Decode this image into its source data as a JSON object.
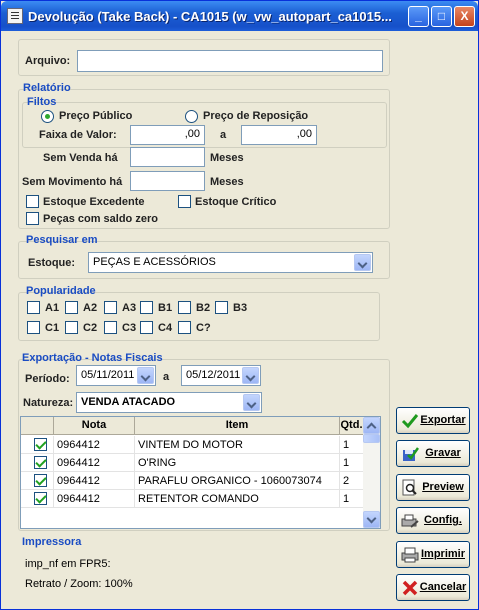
{
  "window": {
    "title": "Devolução (Take Back) - CA1015 (w_vw_autopart_ca1015...",
    "buttons": {
      "minimize": "_",
      "maximize": "□",
      "close": "X"
    }
  },
  "arquivo": {
    "label": "Arquivo:",
    "value": ""
  },
  "relatorio": {
    "title": "Relatório",
    "filtros_title": "Filtos",
    "radio_publico": "Preço Público",
    "radio_reposicao": "Preço de Reposição",
    "selected": "Preço Público",
    "faixa_label": "Faixa de Valor:",
    "faixa_min": ",00",
    "faixa_sep": "a",
    "faixa_max": ",00",
    "sem_venda_label": "Sem Venda há",
    "sem_venda_value": "",
    "sem_venda_unit": "Meses",
    "sem_mov_label": "Sem Movimento há",
    "sem_mov_value": "",
    "sem_mov_unit": "Meses",
    "chk_excedente": "Estoque Excedente",
    "chk_critico": "Estoque Crítico",
    "chk_saldo_zero": "Peças com saldo zero"
  },
  "pesquisar": {
    "title": "Pesquisar em",
    "estoque_label": "Estoque:",
    "estoque_value": "PEÇAS E ACESSÓRIOS"
  },
  "popularidade": {
    "title": "Popularidade",
    "row1": [
      "A1",
      "A2",
      "A3",
      "B1",
      "B2",
      "B3"
    ],
    "row2": [
      "C1",
      "C2",
      "C3",
      "C4",
      "C?"
    ]
  },
  "exportacao": {
    "title": "Exportação - Notas Fiscais",
    "periodo_label": "Período:",
    "periodo_de": "05/11/2011",
    "periodo_sep": "a",
    "periodo_ate": "05/12/2011",
    "natureza_label": "Natureza:",
    "natureza_value": "VENDA ATACADO",
    "columns": [
      "Nota",
      "Item",
      "Qtd."
    ],
    "rows": [
      {
        "nota": "0964412",
        "item": "VINTEM DO MOTOR",
        "qtd": "1"
      },
      {
        "nota": "0964412",
        "item": "O'RING",
        "qtd": "1"
      },
      {
        "nota": "0964412",
        "item": "PARAFLU ORGANICO - 1060073074",
        "qtd": "2"
      },
      {
        "nota": "0964412",
        "item": "RETENTOR COMANDO",
        "qtd": "1"
      }
    ]
  },
  "impressora": {
    "title": "Impressora",
    "line1": "imp_nf em FPR5:",
    "line2": "Retrato / Zoom: 100%"
  },
  "buttons": {
    "exportar": "Exportar",
    "gravar": "Gravar",
    "preview": "Preview",
    "config": "Config.",
    "imprimir": "Imprimir",
    "cancelar": "Cancelar"
  },
  "colors": {
    "section_title": "#1a4cc3",
    "check_green": "#21a121",
    "titlebar": "#1650c9"
  }
}
